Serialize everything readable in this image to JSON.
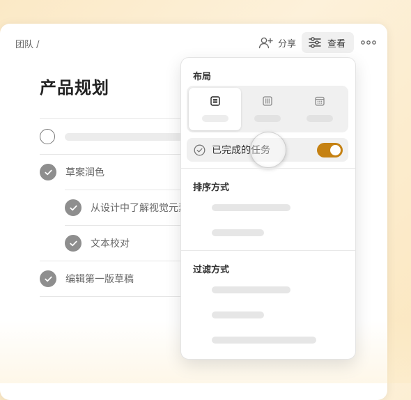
{
  "header": {
    "breadcrumb": "团队 /",
    "share_label": "分享",
    "view_label": "查看",
    "icons": {
      "share": "add-user-icon",
      "view": "sliders-icon",
      "more": "more-horizontal-icon"
    }
  },
  "page": {
    "title": "产品规划",
    "tasks": [
      {
        "label": "",
        "completed": false,
        "subtask": false
      },
      {
        "label": "草案润色",
        "completed": true,
        "subtask": false
      },
      {
        "label": "从设计中了解视觉元素",
        "completed": true,
        "subtask": true
      },
      {
        "label": "文本校对",
        "completed": true,
        "subtask": true
      },
      {
        "label": "编辑第一版草稿",
        "completed": true,
        "subtask": false
      }
    ]
  },
  "view_menu": {
    "layout_heading": "布局",
    "layout_options": [
      {
        "icon": "list-view-icon",
        "selected": true
      },
      {
        "icon": "board-view-icon",
        "selected": false
      },
      {
        "icon": "calendar-view-icon",
        "selected": false
      }
    ],
    "completed_tasks_label": "已完成的任务",
    "completed_tasks_enabled": true,
    "sort_heading": "排序方式",
    "filter_heading": "过滤方式"
  },
  "colors": {
    "toggle_on": "#c58112",
    "check_fill": "#8e8e8e",
    "background": "#fbe9c6"
  }
}
